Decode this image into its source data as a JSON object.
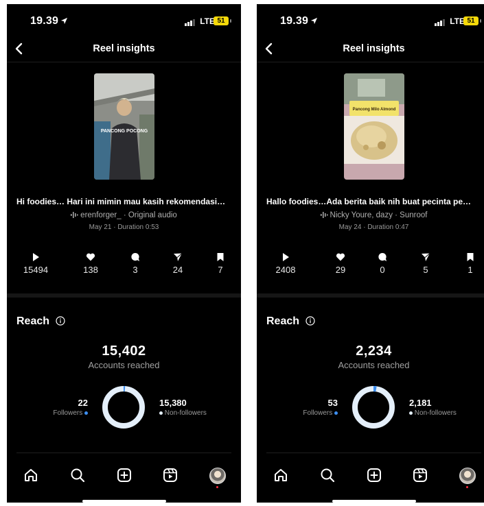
{
  "colors": {
    "background": "#000000",
    "followers": "#3d8ef0",
    "non_followers": "#e4effa",
    "battery": "#f5d90a"
  },
  "left": {
    "status": {
      "time": "19.39",
      "network": "LTE",
      "battery": "51"
    },
    "header": {
      "title": "Reel insights"
    },
    "reel": {
      "caption": "Hi foodies… Hari ini mimin mau kasih rekomendasi…",
      "audio": "erenforger_ · Original audio",
      "meta": "May 21 · Duration 0:53",
      "overlay_text": "PANCONG POCONG"
    },
    "stats": {
      "plays": "15494",
      "likes": "138",
      "comments": "3",
      "shares": "24",
      "saves": "7"
    },
    "reach": {
      "title": "Reach",
      "accounts_reached": "15,402",
      "accounts_label": "Accounts reached",
      "followers": "22",
      "followers_label": "Followers",
      "non_followers": "15,380",
      "non_followers_label": "Non-followers",
      "followers_fraction": 0.0014
    }
  },
  "right": {
    "status": {
      "time": "19.39",
      "network": "LTE",
      "battery": "51"
    },
    "header": {
      "title": "Reel insights"
    },
    "reel": {
      "caption": "Hallo foodies…Ada berita baik nih buat pecinta  pe…",
      "audio": "Nicky Youre, dazy · Sunroof",
      "meta": "May 24 · Duration 0:47",
      "overlay_text": "Pancong Milo Almond"
    },
    "stats": {
      "plays": "2408",
      "likes": "29",
      "comments": "0",
      "shares": "5",
      "saves": "1"
    },
    "reach": {
      "title": "Reach",
      "accounts_reached": "2,234",
      "accounts_label": "Accounts reached",
      "followers": "53",
      "followers_label": "Followers",
      "non_followers": "2,181",
      "non_followers_label": "Non-followers",
      "followers_fraction": 0.0237
    }
  }
}
